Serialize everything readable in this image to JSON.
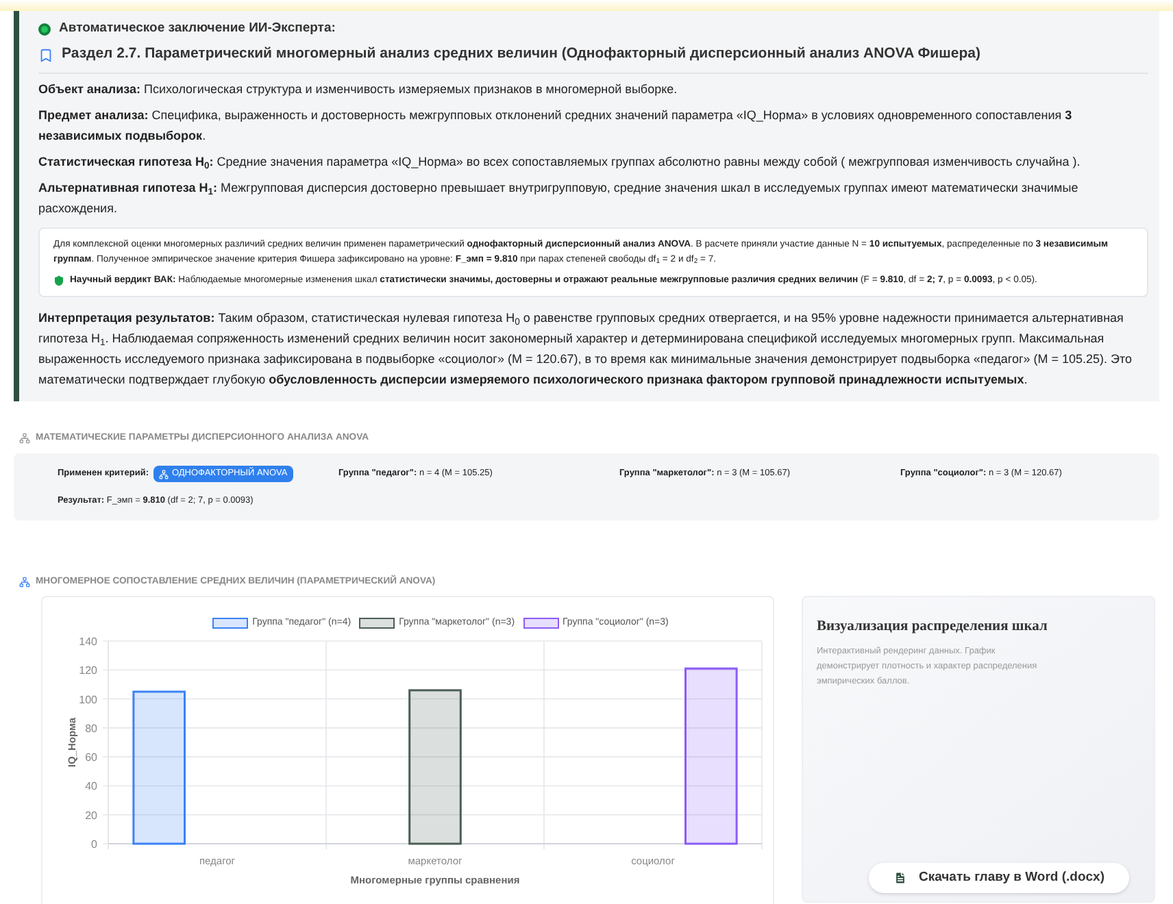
{
  "conclusion": {
    "title": "Автоматическое заключение ИИ-Эксперта:",
    "section_title": "Раздел 2.7. Параметрический многомерный анализ средних величин (Однофакторный дисперсионный анализ ANOVA Фишера)",
    "paragraphs": [
      {
        "label": "Объект анализа:",
        "text": "Психологическая структура и изменчивость измеряемых признаков в многомерной выборке."
      },
      {
        "label": "Предмет анализа:",
        "text": "Специфика, выраженность и достоверность межгрупповых отклонений средних значений параметра «IQ_Норма» в условиях одновременного сопоставления **3 независимых подвыборок**."
      },
      {
        "label": "Статистическая гипотеза H$_{0}$:",
        "text": "Средние значения параметра «IQ_Норма» во всех сопоставляемых группах абсолютно равны между собой ( межгрупповая изменчивость случайна )."
      },
      {
        "label": "Альтернативная гипотеза H$_{1}$:",
        "text": "Межгрупповая дисперсия достоверно превышает внутригрупповую, средние значения шкал в исследуемых группах имеют математически значимые расхождения."
      }
    ],
    "method": {
      "text": "Для комплексной оценки многомерных различий средних величин применен параметрический **однофакторный дисперсионный анализ ANOVA**. В расчете приняли участие данные N = **10 испытуемых**, распределенные по **3 независимым группам**. Полученное эмпирическое значение критерия Фишера зафиксировано на уровне: **F_эмп = 9.810** при парах степеней свободы df$_{1}$ = 2 и df$_{2}$ = 7.",
      "verdict_label": "Научный вердикт ВАК:",
      "verdict_text": "Наблюдаемые многомерные изменения шкал **статистически значимы, достоверны и отражают реальные межгрупповые различия средних величин** (F = **9.810**, df = **2; 7**, p = **0.0093**, p < 0.05)."
    },
    "interpretation": {
      "label": "Интерпретация результатов:",
      "text": "Таким образом, статистическая нулевая гипотеза H$_{0}$ о равенстве групповых средних отвергается, и на 95% уровне надежности принимается альтернативная гипотеза H$_{1}$. Наблюдаемая сопряженность изменений средних величин носит закономерный характер и детерминирована спецификой исследуемых многомерных групп. Максимальная выраженность исследуемого признака зафиксирована в подвыборке «социолог» (M = 120.67), в то время как минимальные значения демонстрирует подвыборка «педагог» (M = 105.25). Это математически подтверждает глубокую **обусловленность дисперсии измеряемого психологического признака фактором групповой принадлежности испытуемых**."
    }
  },
  "params": {
    "title": "МАТЕМАТИЧЕСКИЕ ПАРАМЕТРЫ ДИСПЕРСИОННОГО АНАЛИЗА ANOVA",
    "criterion_label": "Применен критерий:",
    "criterion_badge": "ОДНОФАКТОРНЫЙ ANOVA",
    "groups": [
      {
        "label": "Группа \"педагог\":",
        "text": "n = 4 (M = 105.25)"
      },
      {
        "label": "Группа \"маркетолог\":",
        "text": "n = 3 (M = 105.67)"
      },
      {
        "label": "Группа \"социолог\":",
        "text": "n = 3 (M = 120.67)"
      }
    ],
    "result_label": "Результат:",
    "result_text": "F_эмп = **9.810** (df = 2; 7, p = 0.0093)"
  },
  "comparison": {
    "title": "МНОГОМЕРНОЕ СОПОСТАВЛЕНИЕ СРЕДНИХ ВЕЛИЧИН (ПАРАМЕТРИЧЕСКИЙ ANOVA)",
    "chart_data": {
      "type": "bar",
      "grid": true,
      "legend": "top",
      "xlabel": "Многомерные группы сравнения",
      "ylabel": "IQ_Норма",
      "categories": [
        "педагог",
        "маркетолог",
        "социолог"
      ],
      "series": [
        {
          "name": "Группа \"педагог\" (n=4)",
          "color": "#3b82f6",
          "values": [
            105,
            null,
            null
          ]
        },
        {
          "name": "Группа \"маркетолог\" (n=3)",
          "color": "#4b5e55",
          "values": [
            null,
            106,
            null
          ]
        },
        {
          "name": "Группа \"социолог\" (n=3)",
          "color": "#8b5cf6",
          "values": [
            null,
            null,
            121
          ]
        }
      ],
      "ylim": [
        0,
        140
      ],
      "yticks": [
        0,
        20,
        40,
        60,
        80,
        100,
        120,
        140
      ]
    },
    "panel": {
      "title": "Визуализация распределения шкал",
      "text": "Интерактивный рендеринг данных. График демонстрирует плотность и характер распределения эмпирических баллов.",
      "button": "Скачать главу в Word (.docx)"
    }
  }
}
